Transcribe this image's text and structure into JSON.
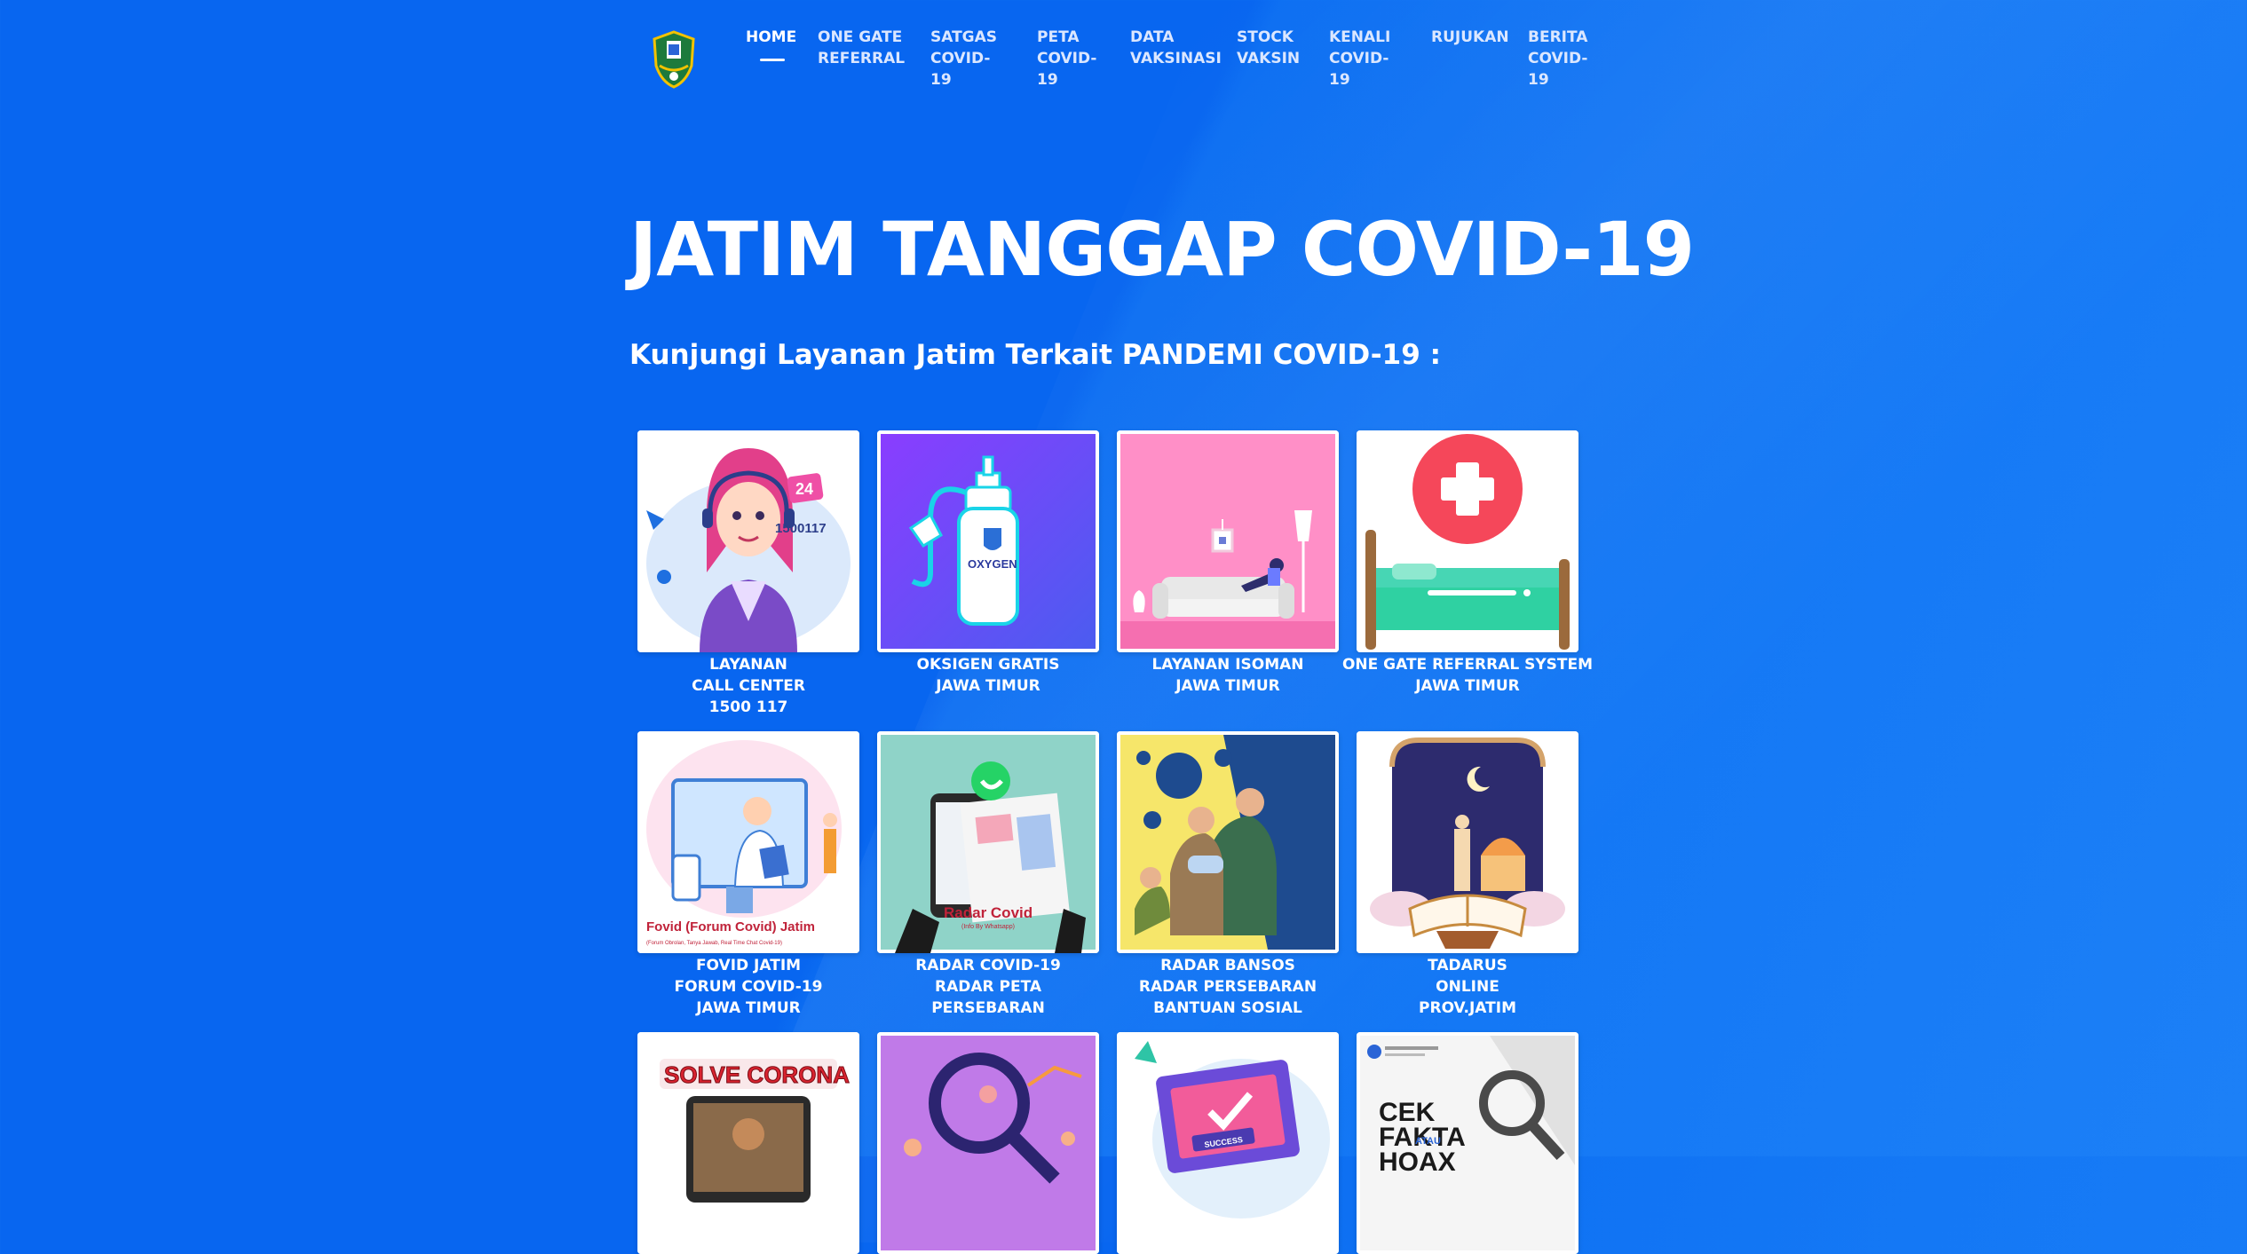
{
  "nav": {
    "items": [
      {
        "label": "HOME",
        "active": true
      },
      {
        "label": "ONE GATE\nREFERRAL"
      },
      {
        "label": "SATGAS\nCOVID-19"
      },
      {
        "label": "PETA\nCOVID-\n19"
      },
      {
        "label": "DATA\nVAKSINASI"
      },
      {
        "label": "STOCK\nVAKSIN"
      },
      {
        "label": "KENALI\nCOVID-19"
      },
      {
        "label": "RUJUKAN"
      },
      {
        "label": "BERITA\nCOVID-19"
      }
    ]
  },
  "hero": {
    "title": "JATIM TANGGAP COVID-19",
    "subtitle": "Kunjungi Layanan Jatim Terkait PANDEMI COVID-19 :"
  },
  "cards": [
    {
      "lines": [
        "LAYANAN",
        "CALL CENTER",
        "1500 117"
      ],
      "badge_text": "24",
      "phone_text": "1500117"
    },
    {
      "lines": [
        "OKSIGEN GRATIS",
        "JAWA TIMUR"
      ],
      "bottle_text": "OXYGEN"
    },
    {
      "lines": [
        "LAYANAN ISOMAN",
        "JAWA TIMUR"
      ]
    },
    {
      "lines": [
        "ONE GATE REFERRAL SYSTEM",
        "JAWA TIMUR"
      ]
    },
    {
      "lines": [
        "FOVID JATIM",
        "FORUM COVID-19",
        "JAWA TIMUR"
      ],
      "banner_text": "Fovid (Forum Covid) Jatim",
      "banner_sub": "(Forum Obrolan, Tanya Jawab, Real Time Chat Covid-19)"
    },
    {
      "lines": [
        "RADAR COVID-19",
        "RADAR PETA",
        "PERSEBARAN"
      ],
      "banner_text": "Radar Covid",
      "banner_sub": "(Info By Whatsapp)"
    },
    {
      "lines": [
        "RADAR BANSOS",
        "RADAR PERSEBARAN",
        "BANTUAN SOSIAL"
      ]
    },
    {
      "lines": [
        "TADARUS",
        "ONLINE",
        "PROV.JATIM"
      ]
    },
    {
      "lines": [],
      "banner_text": "SOLVE CORONA"
    },
    {
      "lines": []
    },
    {
      "lines": [],
      "button_text": "SUCCESS"
    },
    {
      "lines": [],
      "banner_text": "CEK FAKTA HOAX",
      "atau_text": "ATAU"
    }
  ],
  "colors": {
    "background": "#0866f0",
    "text": "#ffffff"
  }
}
